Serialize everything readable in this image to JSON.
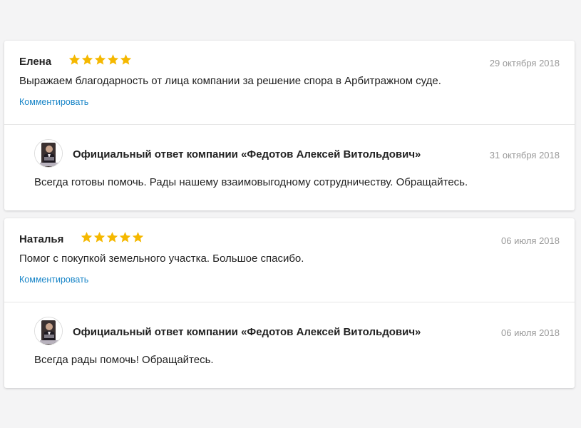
{
  "star_color": "#f5b800",
  "link_color": "#1a86c8",
  "reviews": [
    {
      "author": "Елена",
      "rating": 5,
      "date": "29 октября 2018",
      "text": "Выражаем благодарность от лица компании за решение спора в Арбитражном суде.",
      "comment_label": "Комментировать",
      "reply": {
        "avatar_icon": "lawyer-photo-avatar",
        "title": "Официальный ответ компании «Федотов Алексей Витольдович»",
        "date": "31 октября 2018",
        "text": "Всегда готовы помочь. Рады нашему взаимовыгодному сотрудничеству. Обращайтесь."
      }
    },
    {
      "author": "Наталья",
      "rating": 5,
      "date": "06 июля 2018",
      "text": "Помог с покупкой земельного участка. Большое спасибо.",
      "comment_label": "Комментировать",
      "reply": {
        "avatar_icon": "lawyer-photo-avatar",
        "title": "Официальный ответ компании «Федотов Алексей Витольдович»",
        "date": "06 июля 2018",
        "text": "Всегда рады помочь! Обращайтесь."
      }
    }
  ]
}
